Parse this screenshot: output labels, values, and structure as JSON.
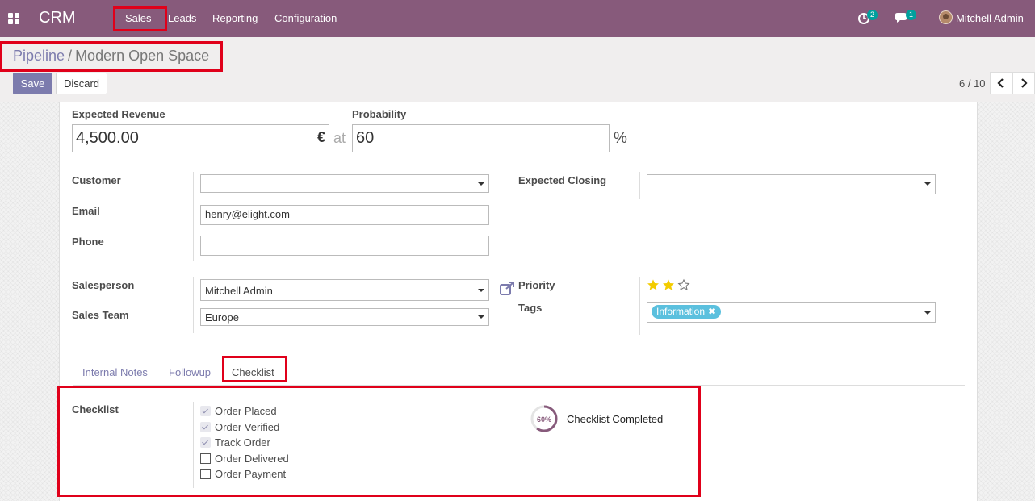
{
  "topbar": {
    "app_name": "CRM",
    "menu": [
      "Sales",
      "Leads",
      "Reporting",
      "Configuration"
    ],
    "activity_count": "2",
    "message_count": "1",
    "user_name": "Mitchell Admin"
  },
  "control_panel": {
    "breadcrumb_parent": "Pipeline",
    "breadcrumb_separator": "/",
    "breadcrumb_current": "Modern Open Space",
    "save_label": "Save",
    "discard_label": "Discard",
    "pager": "6 / 10"
  },
  "form": {
    "expected_revenue_label": "Expected Revenue",
    "expected_revenue_value": "4,500.00",
    "currency_symbol": "€",
    "at_label": "at",
    "probability_label": "Probability",
    "probability_value": "60",
    "percent_sign": "%",
    "customer_label": "Customer",
    "customer_value": "",
    "email_label": "Email",
    "email_value": "henry@elight.com",
    "phone_label": "Phone",
    "phone_value": "",
    "expected_closing_label": "Expected Closing",
    "expected_closing_value": "",
    "salesperson_label": "Salesperson",
    "salesperson_value": "Mitchell Admin",
    "sales_team_label": "Sales Team",
    "sales_team_value": "Europe",
    "priority_label": "Priority",
    "priority_value": 2,
    "priority_max": 3,
    "tags_label": "Tags",
    "tags": [
      "Information"
    ]
  },
  "tabs": [
    "Internal Notes",
    "Followup",
    "Checklist"
  ],
  "active_tab": "Checklist",
  "checklist": {
    "label": "Checklist",
    "items": [
      {
        "label": "Order Placed",
        "checked": true
      },
      {
        "label": "Order Verified",
        "checked": true
      },
      {
        "label": "Track Order",
        "checked": true
      },
      {
        "label": "Order Delivered",
        "checked": false
      },
      {
        "label": "Order Payment",
        "checked": false
      }
    ],
    "progress_text": "60%",
    "progress_value": 60,
    "progress_caption": "Checklist Completed"
  },
  "colors": {
    "topbar": "#875a7b",
    "primary": "#7c7bad",
    "badge": "#00a09d",
    "tag": "#5bc0de",
    "star": "#f3cc00",
    "highlight": "#e0001a"
  }
}
